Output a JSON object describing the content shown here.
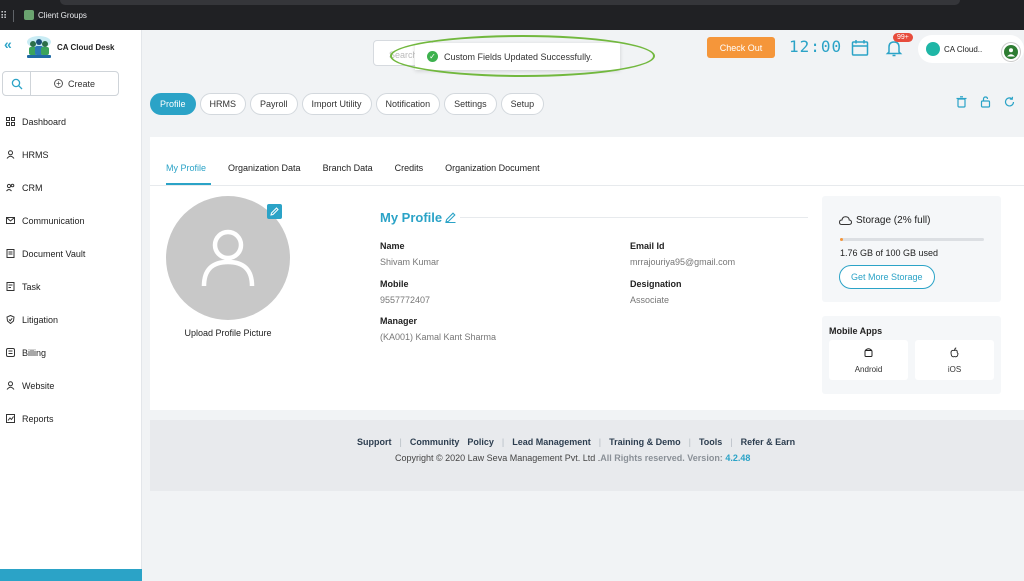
{
  "browser": {
    "bookmark": "Client Groups"
  },
  "sidebar": {
    "brand": "CA Cloud Desk",
    "create_label": "Create",
    "items": [
      {
        "label": "Dashboard",
        "icon": "grid-icon"
      },
      {
        "label": "HRMS",
        "icon": "user-icon"
      },
      {
        "label": "CRM",
        "icon": "crm-icon"
      },
      {
        "label": "Communication",
        "icon": "mail-icon"
      },
      {
        "label": "Document Vault",
        "icon": "document-icon"
      },
      {
        "label": "Task",
        "icon": "task-icon"
      },
      {
        "label": "Litigation",
        "icon": "shield-icon"
      },
      {
        "label": "Billing",
        "icon": "billing-icon"
      },
      {
        "label": "Website",
        "icon": "user-icon"
      },
      {
        "label": "Reports",
        "icon": "chart-icon"
      }
    ]
  },
  "header": {
    "search_placeholder": "Search",
    "checkout_label": "Check Out",
    "clock": "12:00",
    "notif_count": "99+",
    "user_name": "CA Cloud.."
  },
  "toast": {
    "message": "Custom Fields Updated Successfully."
  },
  "module_tabs": [
    "Profile",
    "HRMS",
    "Payroll",
    "Import Utility",
    "Notification",
    "Settings",
    "Setup"
  ],
  "sub_tabs": [
    "My Profile",
    "Organization Data",
    "Branch Data",
    "Credits",
    "Organization Document"
  ],
  "profile": {
    "upload_label": "Upload Profile Picture",
    "title": "My Profile",
    "name_label": "Name",
    "name": "Shivam Kumar",
    "mobile_label": "Mobile",
    "mobile": "9557772407",
    "manager_label": "Manager",
    "manager": "(KA001) Kamal Kant Sharma",
    "email_label": "Email Id",
    "email": "mrrajouriya95@gmail.com",
    "designation_label": "Designation",
    "designation": "Associate"
  },
  "storage": {
    "title": "Storage (2% full)",
    "fraction_used": 0.02,
    "used_text": "1.76 GB of 100 GB used",
    "button": "Get More Storage"
  },
  "mobile_apps": {
    "title": "Mobile Apps",
    "android": "Android",
    "ios": "iOS"
  },
  "footer": {
    "links": [
      "Support",
      "Community",
      "Policy",
      "Lead Management",
      "Training & Demo",
      "Tools",
      "Refer & Earn"
    ],
    "copyright": "Copyright © 2020 Law Seva Management Pvt. Ltd .",
    "rights": "All Rights reserved.",
    "version_label": "Version:",
    "version": "4.2.48"
  },
  "colors": {
    "accent": "#2ba3c7",
    "checkout": "#f5963a",
    "success": "#3db14e",
    "highlight_ring": "#72b83e"
  }
}
